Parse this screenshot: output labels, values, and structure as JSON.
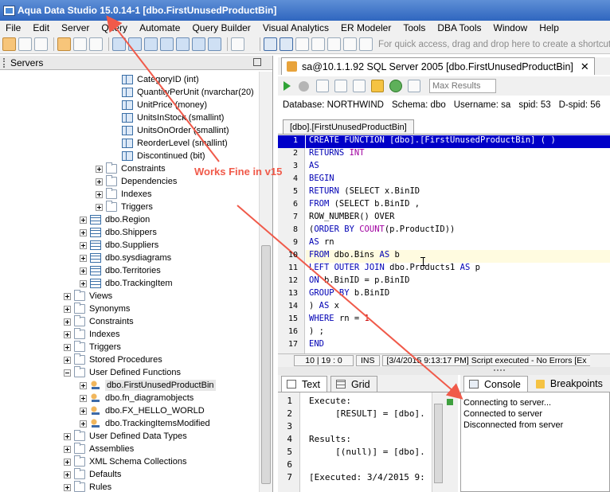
{
  "window": {
    "title": "Aqua Data Studio 15.0.14-1 [dbo.FirstUnusedProductBin]"
  },
  "menu": [
    "File",
    "Edit",
    "Server",
    "Query",
    "Automate",
    "Query Builder",
    "Visual Analytics",
    "ER Modeler",
    "Tools",
    "DBA Tools",
    "Window",
    "Help"
  ],
  "toolbar": {
    "quick_access": "For quick access, drag and drop here to create a shortcut"
  },
  "servers_panel": {
    "title": "Servers",
    "rows": [
      {
        "level": 8,
        "icon": "column",
        "exp": "",
        "label": "CategoryID (int)"
      },
      {
        "level": 8,
        "icon": "column",
        "exp": "",
        "label": "QuantityPerUnit (nvarchar(20)"
      },
      {
        "level": 8,
        "icon": "column",
        "exp": "",
        "label": "UnitPrice (money)"
      },
      {
        "level": 8,
        "icon": "column",
        "exp": "",
        "label": "UnitsInStock (smallint)"
      },
      {
        "level": 8,
        "icon": "column",
        "exp": "",
        "label": "UnitsOnOrder (smallint)"
      },
      {
        "level": 8,
        "icon": "column",
        "exp": "",
        "label": "ReorderLevel (smallint)"
      },
      {
        "level": 8,
        "icon": "column",
        "exp": "",
        "label": "Discontinued (bit)"
      },
      {
        "level": 7,
        "icon": "folder",
        "exp": "+",
        "label": "Constraints"
      },
      {
        "level": 7,
        "icon": "folder",
        "exp": "+",
        "label": "Dependencies"
      },
      {
        "level": 7,
        "icon": "folder",
        "exp": "+",
        "label": "Indexes"
      },
      {
        "level": 7,
        "icon": "folder",
        "exp": "+",
        "label": "Triggers"
      },
      {
        "level": 6,
        "icon": "table",
        "exp": "+",
        "label": "dbo.Region"
      },
      {
        "level": 6,
        "icon": "table",
        "exp": "+",
        "label": "dbo.Shippers"
      },
      {
        "level": 6,
        "icon": "table",
        "exp": "+",
        "label": "dbo.Suppliers"
      },
      {
        "level": 6,
        "icon": "table",
        "exp": "+",
        "label": "dbo.sysdiagrams"
      },
      {
        "level": 6,
        "icon": "table",
        "exp": "+",
        "label": "dbo.Territories"
      },
      {
        "level": 6,
        "icon": "table",
        "exp": "+",
        "label": "dbo.TrackingItem"
      },
      {
        "level": 5,
        "icon": "folder",
        "exp": "+",
        "label": "Views"
      },
      {
        "level": 5,
        "icon": "folder",
        "exp": "+",
        "label": "Synonyms"
      },
      {
        "level": 5,
        "icon": "folder",
        "exp": "+",
        "label": "Constraints"
      },
      {
        "level": 5,
        "icon": "folder",
        "exp": "+",
        "label": "Indexes"
      },
      {
        "level": 5,
        "icon": "folder",
        "exp": "+",
        "label": "Triggers"
      },
      {
        "level": 5,
        "icon": "folder",
        "exp": "+",
        "label": "Stored Procedures"
      },
      {
        "level": 5,
        "icon": "folder",
        "exp": "-",
        "label": "User Defined Functions"
      },
      {
        "level": 6,
        "icon": "function",
        "exp": "+",
        "label": "dbo.FirstUnusedProductBin",
        "selected": true
      },
      {
        "level": 6,
        "icon": "function",
        "exp": "+",
        "label": "dbo.fn_diagramobjects"
      },
      {
        "level": 6,
        "icon": "function",
        "exp": "+",
        "label": "dbo.FX_HELLO_WORLD"
      },
      {
        "level": 6,
        "icon": "function",
        "exp": "+",
        "label": "dbo.TrackingItemsModified"
      },
      {
        "level": 5,
        "icon": "folder",
        "exp": "+",
        "label": "User Defined Data Types"
      },
      {
        "level": 5,
        "icon": "folder",
        "exp": "+",
        "label": "Assemblies"
      },
      {
        "level": 5,
        "icon": "folder",
        "exp": "+",
        "label": "XML Schema Collections"
      },
      {
        "level": 5,
        "icon": "folder",
        "exp": "+",
        "label": "Defaults"
      },
      {
        "level": 5,
        "icon": "folder",
        "exp": "+",
        "label": "Rules"
      }
    ]
  },
  "editor_tab": {
    "label": "sa@10.1.1.92 SQL Server 2005 [dbo.FirstUnusedProductBin]",
    "close": "✕"
  },
  "editor_toolbar": {
    "max_results_placeholder": "Max Results"
  },
  "db_info": {
    "database": "Database:  NORTHWIND",
    "schema": "Schema:  dbo",
    "username": "Username:  sa",
    "spid": "spid:  53",
    "dspid": "D-spid:  56"
  },
  "script_tab": "[dbo].[FirstUnusedProductBin]",
  "code_lines": [
    {
      "n": "1",
      "parts": [
        [
          "k",
          "CREATE FUNCTION "
        ],
        [
          "",
          "[dbo].[FirstUnusedProductBin] ( )"
        ]
      ],
      "current": true
    },
    {
      "n": "2",
      "parts": [
        [
          "k",
          "RETURNS "
        ],
        [
          "f",
          "INT"
        ]
      ]
    },
    {
      "n": "3",
      "parts": [
        [
          "k",
          "AS"
        ]
      ]
    },
    {
      "n": "4",
      "parts": [
        [
          "k",
          "BEGIN"
        ]
      ]
    },
    {
      "n": "5",
      "parts": [
        [
          "k",
          "RETURN "
        ],
        [
          "",
          "(SELECT x.BinID"
        ]
      ]
    },
    {
      "n": "6",
      "parts": [
        [
          "k",
          "FROM "
        ],
        [
          "",
          "(SELECT b.BinID ,"
        ]
      ]
    },
    {
      "n": "7",
      "parts": [
        [
          "",
          "ROW_NUMBER() OVER"
        ]
      ]
    },
    {
      "n": "8",
      "parts": [
        [
          "",
          "("
        ],
        [
          "k",
          "ORDER BY "
        ],
        [
          "f",
          "COUNT"
        ],
        [
          "",
          "(p.ProductID))"
        ]
      ]
    },
    {
      "n": "9",
      "parts": [
        [
          "k",
          "AS "
        ],
        [
          "",
          "rn"
        ]
      ]
    },
    {
      "n": "10",
      "parts": [
        [
          "k",
          "FROM "
        ],
        [
          "",
          "dbo.Bins "
        ],
        [
          "k",
          "AS "
        ],
        [
          "",
          "b"
        ]
      ],
      "highlight": true
    },
    {
      "n": "11",
      "parts": [
        [
          "k",
          "LEFT OUTER JOIN "
        ],
        [
          "",
          "dbo.Products1 "
        ],
        [
          "k",
          "AS "
        ],
        [
          "",
          "p"
        ]
      ]
    },
    {
      "n": "12",
      "parts": [
        [
          "k",
          "ON "
        ],
        [
          "",
          "b.BinID = p.BinID"
        ]
      ]
    },
    {
      "n": "13",
      "parts": [
        [
          "k",
          "GROUP BY "
        ],
        [
          "",
          "b.BinID"
        ]
      ]
    },
    {
      "n": "14",
      "parts": [
        [
          "",
          ") "
        ],
        [
          "k",
          "AS "
        ],
        [
          "",
          "x"
        ]
      ]
    },
    {
      "n": "15",
      "parts": [
        [
          "k",
          "WHERE "
        ],
        [
          "",
          "rn = "
        ],
        [
          "r",
          "1"
        ]
      ]
    },
    {
      "n": "16",
      "parts": [
        [
          "",
          ") ;"
        ]
      ]
    },
    {
      "n": "17",
      "parts": [
        [
          "k",
          "END"
        ]
      ]
    }
  ],
  "status": {
    "position": "10 | 19 : 0",
    "mode": "INS",
    "message": "[3/4/2015 9:13:17 PM] Script executed - No Errors [Ex"
  },
  "results": {
    "tabs": [
      "Text",
      "Grid"
    ],
    "line_numbers": [
      "1",
      "2",
      "3",
      "4",
      "5",
      "6",
      "7"
    ],
    "lines": [
      "Execute:",
      "     [RESULT] = [dbo].",
      "",
      "Results:",
      "     [(null)] = [dbo].",
      "",
      "[Executed: 3/4/2015 9:"
    ]
  },
  "console": {
    "tabs": [
      "Console",
      "Breakpoints"
    ],
    "lines": [
      "Connecting to server...",
      "Connected to server",
      "Disconnected from server"
    ]
  },
  "annotation": {
    "text": "Works Fine in v15",
    "color": "#f05a4a"
  }
}
